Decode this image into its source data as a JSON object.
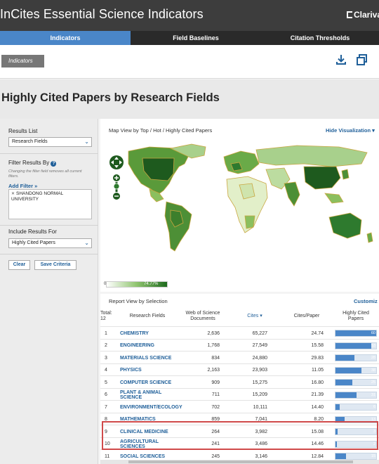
{
  "app": {
    "title": "InCites Essential Science Indicators",
    "brand": "Clariva"
  },
  "nav": {
    "tabs": [
      "Indicators",
      "Field Baselines",
      "Citation Thresholds"
    ],
    "active_index": 0
  },
  "toolbar": {
    "breadcrumb": "Indicators"
  },
  "page": {
    "title": "Highly Cited Papers by Research Fields"
  },
  "sidebar": {
    "results_list_label": "Results List",
    "results_list_value": "Research Fields",
    "filter_label": "Filter Results By",
    "filter_note": "Changing the filter field removes all current filters.",
    "add_filter": "Add Filter »",
    "filter_chip": "SHANDONG NORMAL UNIVERSITY",
    "include_label": "Include Results For",
    "include_value": "Highly Cited Papers",
    "clear_label": "Clear",
    "save_label": "Save Criteria"
  },
  "visualization": {
    "title": "Map View by Top / Hot / Highly Cited Papers",
    "toggle": "Hide Visualization",
    "legend_min": "0",
    "legend_max": "74.77%"
  },
  "report": {
    "title": "Report View by Selection",
    "customize": "Customiz",
    "columns": {
      "total": "Total: 12",
      "field": "Research Fields",
      "docs": "Web of Science Documents",
      "cites": "Cites",
      "cites_per_paper": "Cites/Paper",
      "hcp": "Highly Cited Papers"
    },
    "rows": [
      {
        "rank": "1",
        "field": "CHEMISTRY",
        "docs": "2,636",
        "cites": "65,227",
        "cpp": "24.74",
        "hcp": "60",
        "hcp_value": 60
      },
      {
        "rank": "2",
        "field": "ENGINEERING",
        "docs": "1,768",
        "cites": "27,549",
        "cpp": "15.58",
        "hcp": "53",
        "hcp_value": 53
      },
      {
        "rank": "3",
        "field": "MATERIALS SCIENCE",
        "docs": "834",
        "cites": "24,880",
        "cpp": "29.83",
        "hcp": "28",
        "hcp_value": 28
      },
      {
        "rank": "4",
        "field": "PHYSICS",
        "docs": "2,163",
        "cites": "23,903",
        "cpp": "11.05",
        "hcp": "38",
        "hcp_value": 38
      },
      {
        "rank": "5",
        "field": "COMPUTER SCIENCE",
        "docs": "909",
        "cites": "15,275",
        "cpp": "16.80",
        "hcp": "25",
        "hcp_value": 25
      },
      {
        "rank": "6",
        "field": "PLANT & ANIMAL SCIENCE",
        "docs": "711",
        "cites": "15,209",
        "cpp": "21.39",
        "hcp": "31",
        "hcp_value": 31
      },
      {
        "rank": "7",
        "field": "ENVIRONMENT/ECOLOGY",
        "docs": "702",
        "cites": "10,111",
        "cpp": "14.40",
        "hcp": "6",
        "hcp_value": 6
      },
      {
        "rank": "8",
        "field": "MATHEMATICS",
        "docs": "859",
        "cites": "7,041",
        "cpp": "8.20",
        "hcp": "13",
        "hcp_value": 13
      },
      {
        "rank": "9",
        "field": "CLINICAL MEDICINE",
        "docs": "264",
        "cites": "3,982",
        "cpp": "15.08",
        "hcp": "3",
        "hcp_value": 3
      },
      {
        "rank": "10",
        "field": "AGRICULTURAL SCIENCES",
        "docs": "241",
        "cites": "3,486",
        "cpp": "14.46",
        "hcp": "2",
        "hcp_value": 2
      },
      {
        "rank": "11",
        "field": "SOCIAL SCIENCES",
        "docs": "245",
        "cites": "3,146",
        "cpp": "12.84",
        "hcp": "15",
        "hcp_value": 15
      }
    ]
  }
}
